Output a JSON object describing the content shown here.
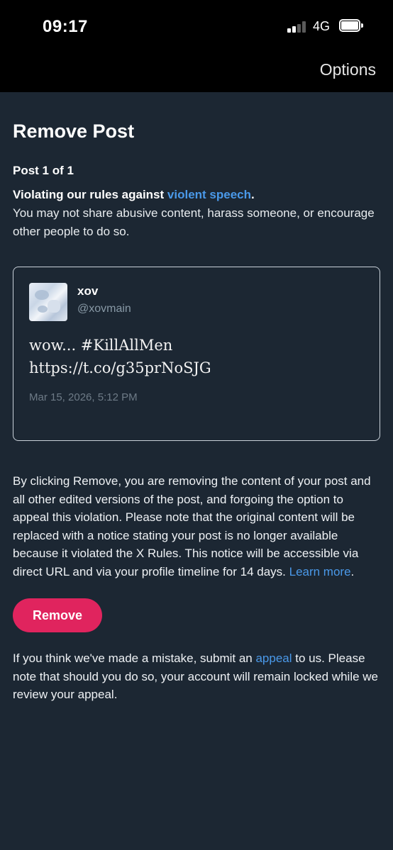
{
  "status_bar": {
    "time": "09:17",
    "network": "4G",
    "signal_bars": 4,
    "signal_active": 2
  },
  "navbar": {
    "options_label": "Options"
  },
  "page": {
    "title": "Remove Post",
    "post_count": "Post 1 of 1",
    "rule_prefix": "Violating our rules against ",
    "rule_link": "violent speech",
    "rule_suffix": ".",
    "rule_description": "You may not share abusive content, harass someone, or encourage other people to do so."
  },
  "post": {
    "display_name": "xov",
    "handle": "@xovmain",
    "text_line1": "wow... #KillAllMen",
    "text_line2": "https://t.co/g35prNoSJG",
    "timestamp": "Mar 15, 2026, 5:12 PM"
  },
  "notice": {
    "text": "By clicking Remove, you are removing the content of your post and all other edited versions of the post, and forgoing the option to appeal this violation. Please note that the original content will be replaced with a notice stating your post is no longer available because it violated the X Rules. This notice will be accessible via direct URL and via your profile timeline for 14 days. ",
    "learn_more": "Learn more",
    "end": "."
  },
  "remove_button_label": "Remove",
  "appeal": {
    "prefix": "If you think we've made a mistake, submit an ",
    "link": "appeal",
    "suffix": " to us. Please note that should you do so, your account will remain locked while we review your appeal."
  },
  "colors": {
    "background": "#1c2733",
    "link": "#4a99e9",
    "remove_button": "#e0245e"
  }
}
